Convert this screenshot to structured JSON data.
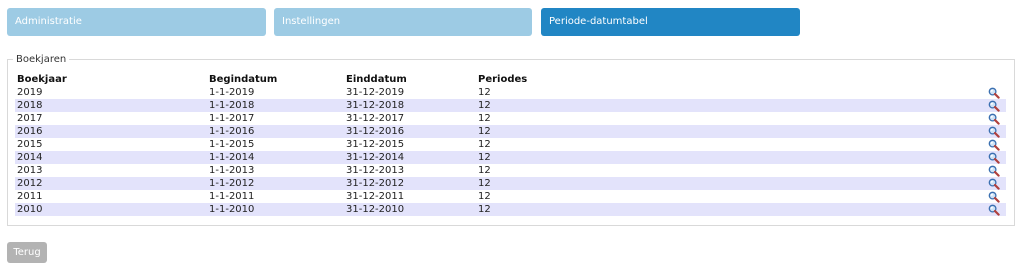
{
  "tabs": [
    {
      "label": "Administratie"
    },
    {
      "label": "Instellingen"
    },
    {
      "label": "Periode-datumtabel"
    }
  ],
  "active_tab_color": "#2186c4",
  "inactive_tab_color": "#9dcbe4",
  "section": {
    "legend": "Boekjaren",
    "columns": {
      "year": "Boekjaar",
      "start": "Begindatum",
      "end": "Einddatum",
      "periods": "Periodes"
    },
    "row_action_icon": "magnifier-icon",
    "rows": [
      {
        "year": "2019",
        "start": "1-1-2019",
        "end": "31-12-2019",
        "periods": "12"
      },
      {
        "year": "2018",
        "start": "1-1-2018",
        "end": "31-12-2018",
        "periods": "12"
      },
      {
        "year": "2017",
        "start": "1-1-2017",
        "end": "31-12-2017",
        "periods": "12"
      },
      {
        "year": "2016",
        "start": "1-1-2016",
        "end": "31-12-2016",
        "periods": "12"
      },
      {
        "year": "2015",
        "start": "1-1-2015",
        "end": "31-12-2015",
        "periods": "12"
      },
      {
        "year": "2014",
        "start": "1-1-2014",
        "end": "31-12-2014",
        "periods": "12"
      },
      {
        "year": "2013",
        "start": "1-1-2013",
        "end": "31-12-2013",
        "periods": "12"
      },
      {
        "year": "2012",
        "start": "1-1-2012",
        "end": "31-12-2012",
        "periods": "12"
      },
      {
        "year": "2011",
        "start": "1-1-2011",
        "end": "31-12-2011",
        "periods": "12"
      },
      {
        "year": "2010",
        "start": "1-1-2010",
        "end": "31-12-2010",
        "periods": "12"
      }
    ]
  },
  "back_button": {
    "label": "Terug"
  }
}
